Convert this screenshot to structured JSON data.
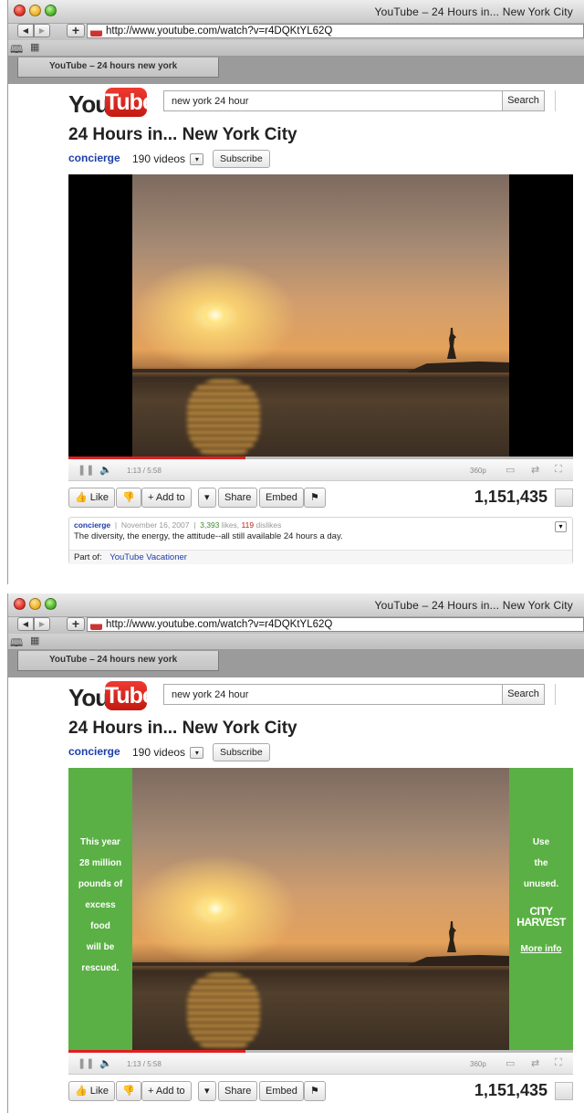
{
  "windows": [
    {
      "id": "w1",
      "title": "YouTube – 24 Hours in... New York City",
      "url": "http://www.youtube.com/watch?v=r4DQKtYL62Q",
      "tab_label": "YouTube – 24 hours new york",
      "search_value": "new york 24 hour",
      "search_button": "Search",
      "video_title": "24 Hours in... New York City",
      "channel": "concierge",
      "video_count": "190 videos",
      "subscribe": "Subscribe",
      "time": "1:13 / 5:58",
      "quality": "360p",
      "progress_fraction": 0.35,
      "buffer_fraction": 0.05,
      "like": "Like",
      "add_to": "Add to",
      "share": "Share",
      "embed": "Embed",
      "views": "1,151,435",
      "info_user": "concierge",
      "info_date": "November 16, 2007",
      "info_likes": "3,393",
      "info_likes_label": "likes,",
      "info_dislikes": "119",
      "info_dislikes_label": "dislikes",
      "description": "The diversity, the energy, the attitude--all still available 24 hours a day.",
      "part_of_label": "Part of:",
      "part_of_link": "YouTube Vacationer"
    },
    {
      "id": "w2",
      "title": "YouTube – 24 Hours in... New York City",
      "url": "http://www.youtube.com/watch?v=r4DQKtYL62Q",
      "tab_label": "YouTube – 24 hours new york",
      "search_value": "new york 24 hour",
      "search_button": "Search",
      "video_title": "24 Hours in... New York City",
      "channel": "concierge",
      "video_count": "190 videos",
      "subscribe": "Subscribe",
      "ad_left": [
        "This year",
        "28 million",
        "pounds of",
        "excess",
        "food",
        "will be",
        "rescued."
      ],
      "ad_right": [
        "Use",
        "the",
        "unused."
      ],
      "ad_brand": "CITY HARVEST",
      "ad_more": "More info",
      "time": "1:13 / 5:58",
      "quality": "360p",
      "progress_fraction": 0.35,
      "buffer_fraction": 0.05,
      "like": "Like",
      "add_to": "Add to",
      "share": "Share",
      "embed": "Embed",
      "views": "1,151,435"
    }
  ],
  "colors": {
    "ad_green": "#5ab044",
    "link_blue": "#1c3ea9",
    "progress_red": "#e02020"
  }
}
